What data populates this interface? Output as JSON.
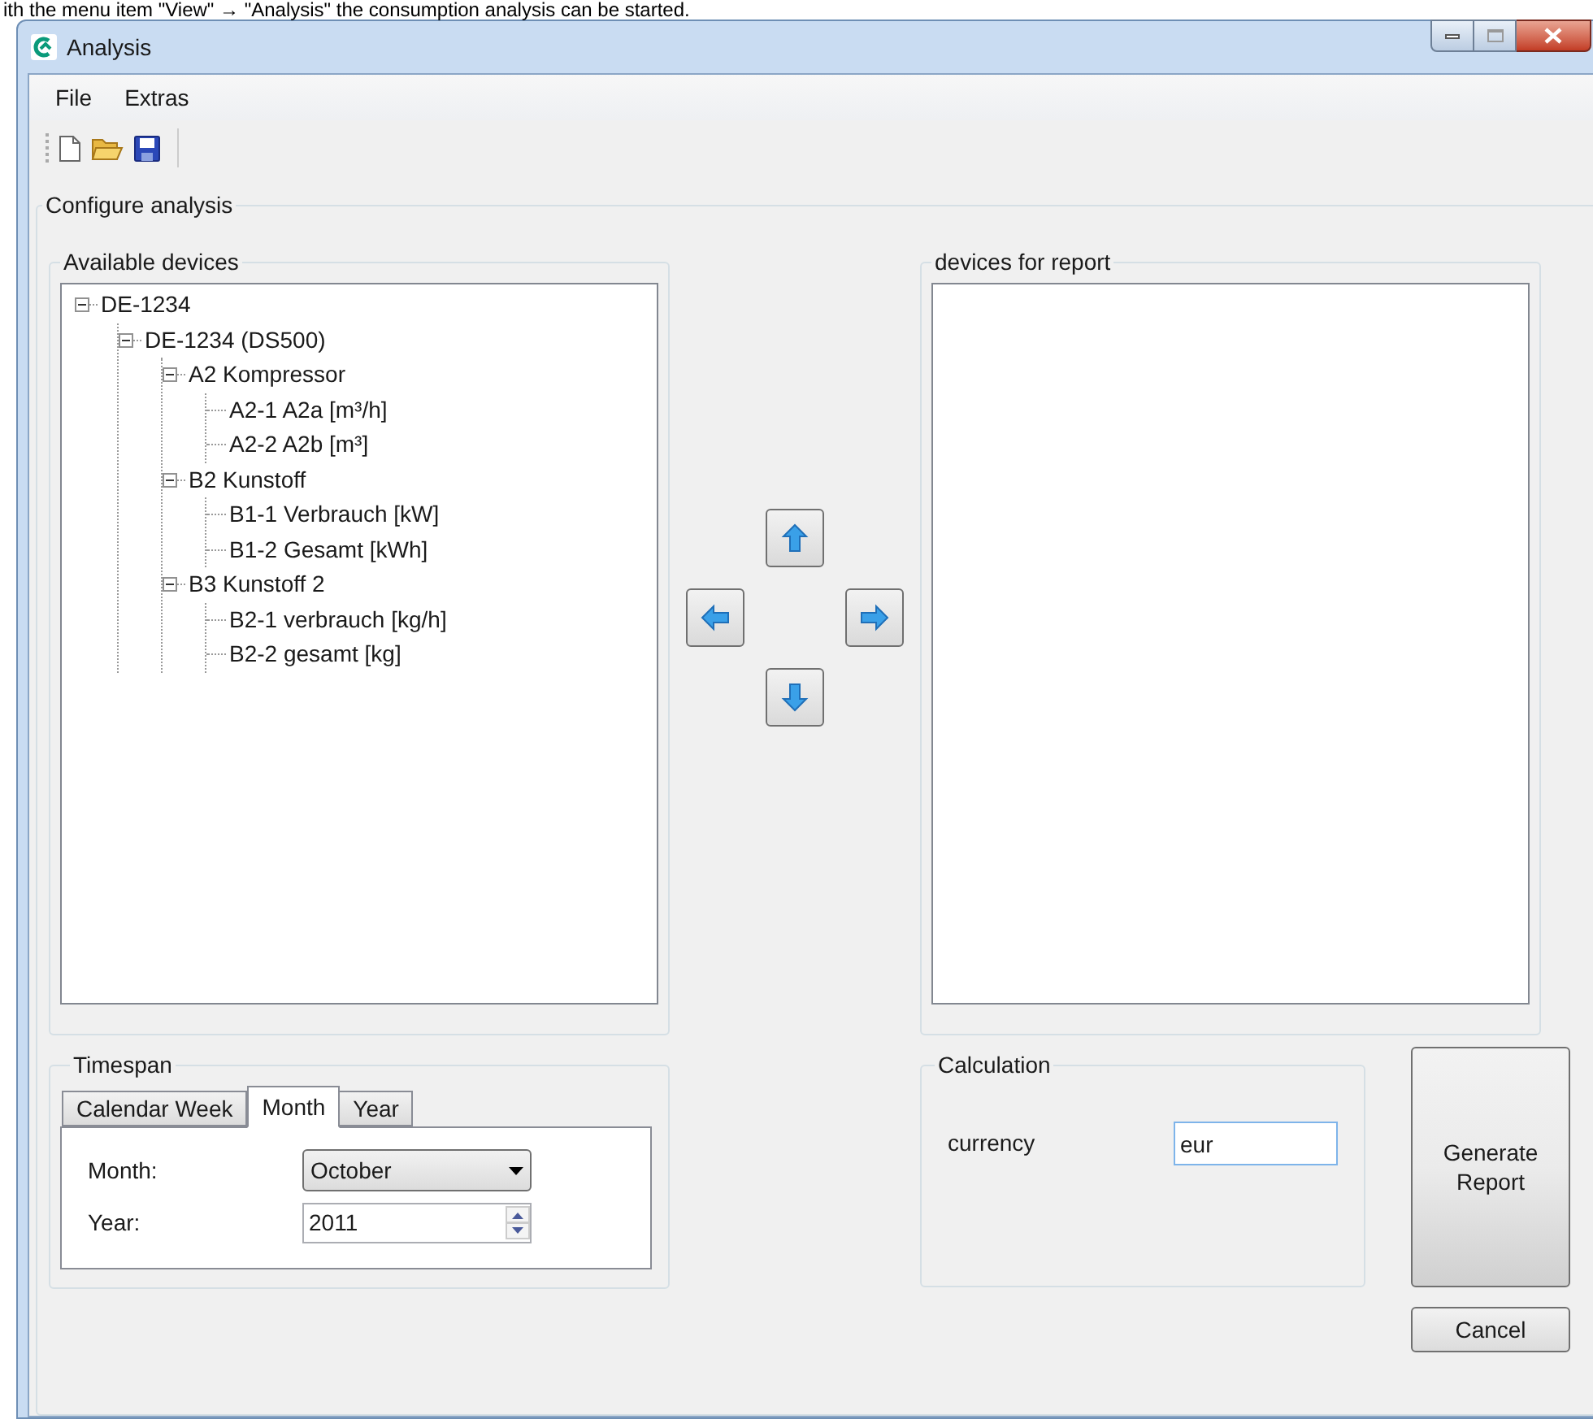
{
  "caption": "ith the menu item \"View\" → \"Analysis\" the consumption analysis can be started.",
  "window": {
    "title": "Analysis"
  },
  "menu": [
    {
      "label": "File"
    },
    {
      "label": "Extras"
    }
  ],
  "configure": {
    "title": "Configure analysis",
    "available": {
      "title": "Available devices",
      "tree": [
        {
          "label": "DE-1234",
          "expanded": true,
          "children": [
            {
              "label": "DE-1234 (DS500)",
              "expanded": true,
              "children": [
                {
                  "label": "A2 Kompressor",
                  "expanded": true,
                  "children": [
                    {
                      "label": "A2-1 A2a [m³/h]"
                    },
                    {
                      "label": "A2-2 A2b [m³]"
                    }
                  ]
                },
                {
                  "label": "B2 Kunstoff",
                  "expanded": true,
                  "children": [
                    {
                      "label": "B1-1 Verbrauch [kW]"
                    },
                    {
                      "label": "B1-2 Gesamt [kWh]"
                    }
                  ]
                },
                {
                  "label": "B3 Kunstoff 2",
                  "expanded": true,
                  "children": [
                    {
                      "label": "B2-1 verbrauch [kg/h]"
                    },
                    {
                      "label": "B2-2 gesamt [kg]"
                    }
                  ]
                }
              ]
            }
          ]
        }
      ]
    },
    "report": {
      "title": "devices for report"
    },
    "timespan": {
      "title": "Timespan",
      "tabs": [
        {
          "label": "Calendar Week",
          "selected": false
        },
        {
          "label": "Month",
          "selected": true
        },
        {
          "label": "Year",
          "selected": false
        }
      ],
      "month_label": "Month:",
      "month_value": "October",
      "year_label": "Year:",
      "year_value": "2011"
    },
    "calculation": {
      "title": "Calculation",
      "currency_label": "currency",
      "currency_value": "eur"
    },
    "buttons": {
      "generate": "Generate Report",
      "cancel": "Cancel"
    }
  }
}
